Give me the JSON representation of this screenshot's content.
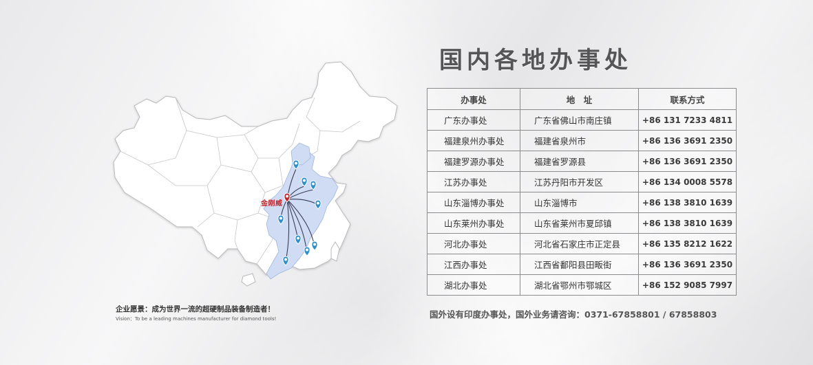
{
  "title": "国内各地办事处",
  "map": {
    "hq_label": "金刚威"
  },
  "vision": {
    "cn": "企业愿景：成为世界一流的超硬制品装备制造者！",
    "en": "Vision：To be a leading machines manufacturer for diamond tools!"
  },
  "table": {
    "headers": [
      "办事处",
      "地　址",
      "联系方式"
    ],
    "rows": [
      {
        "office": "广东办事处",
        "address": "广东省佛山市南庄镇",
        "phone": "+86 131 7233 4811"
      },
      {
        "office": "福建泉州办事处",
        "address": "福建省泉州市",
        "phone": "+86 136 3691 2350"
      },
      {
        "office": "福建罗源办事处",
        "address": "福建省罗源县",
        "phone": "+86 136 3691 2350"
      },
      {
        "office": "江苏办事处",
        "address": "江苏丹阳市开发区",
        "phone": "+86 134 0008 5578"
      },
      {
        "office": "山东淄博办事处",
        "address": "山东淄博市",
        "phone": "+86 138 3810 1639"
      },
      {
        "office": "山东莱州办事处",
        "address": "山东省莱州市夏邱镇",
        "phone": "+86 138 3810 1639"
      },
      {
        "office": "河北办事处",
        "address": "河北省石家庄市正定县",
        "phone": "+86 135 8212 1622"
      },
      {
        "office": "江西办事处",
        "address": "江西省鄱阳县田畈街",
        "phone": "+86 136 3691 2350"
      },
      {
        "office": "湖北办事处",
        "address": "湖北省鄂州市鄂城区",
        "phone": "+86 152 9085 7997"
      }
    ]
  },
  "footnote": "国外设有印度办事处，国外业务请咨询：0371-67858801 / 67858803",
  "colors": {
    "map_fill": "#ffffff",
    "map_border": "#b9b9bd",
    "highlight_fill": "#cfdcf3",
    "marker": "#2f8fc9",
    "hq_marker": "#c0262c",
    "route": "#3a3a55"
  }
}
